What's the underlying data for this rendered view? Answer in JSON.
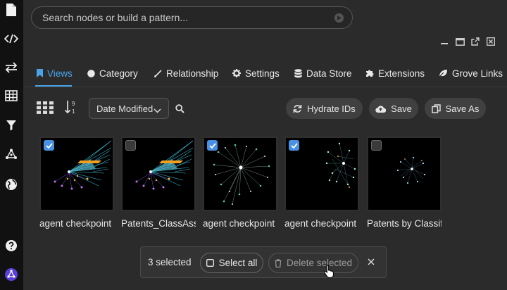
{
  "rail": {
    "items": [
      {
        "name": "document-icon"
      },
      {
        "name": "code-icon"
      },
      {
        "name": "swap-arrows-icon"
      },
      {
        "name": "table-icon"
      },
      {
        "name": "filter-icon"
      },
      {
        "name": "graph-nodes-icon"
      },
      {
        "name": "globe-icon"
      },
      {
        "name": "help-icon"
      },
      {
        "name": "app-logo-icon"
      }
    ]
  },
  "search": {
    "placeholder": "Search nodes or build a pattern..."
  },
  "tabs": [
    {
      "label": "Views",
      "icon": "bookmark-icon",
      "active": true
    },
    {
      "label": "Category",
      "icon": "circle-icon",
      "active": false
    },
    {
      "label": "Relationship",
      "icon": "line-icon",
      "active": false
    },
    {
      "label": "Settings",
      "icon": "gear-icon",
      "active": false
    },
    {
      "label": "Data Store",
      "icon": "database-icon",
      "active": false
    },
    {
      "label": "Extensions",
      "icon": "puzzle-icon",
      "active": false
    },
    {
      "label": "Grove Links",
      "icon": "leaf-icon",
      "active": false
    }
  ],
  "toolbar": {
    "sort_value": "Date Modified",
    "hydrate_label": "Hydrate IDs",
    "save_label": "Save",
    "save_as_label": "Save As"
  },
  "cards": [
    {
      "caption": "agent checkpoint",
      "selected": true
    },
    {
      "caption": "Patents_ClassAss",
      "selected": false
    },
    {
      "caption": "agent checkpoint",
      "selected": true
    },
    {
      "caption": "agent checkpoint",
      "selected": true
    },
    {
      "caption": "Patents by Classif",
      "selected": false
    }
  ],
  "selection_bar": {
    "count_text": "3 selected",
    "select_all_label": "Select all",
    "delete_label": "Delete selected"
  },
  "colors": {
    "accent": "#4aa3e8",
    "checkbox": "#4a90e2"
  }
}
